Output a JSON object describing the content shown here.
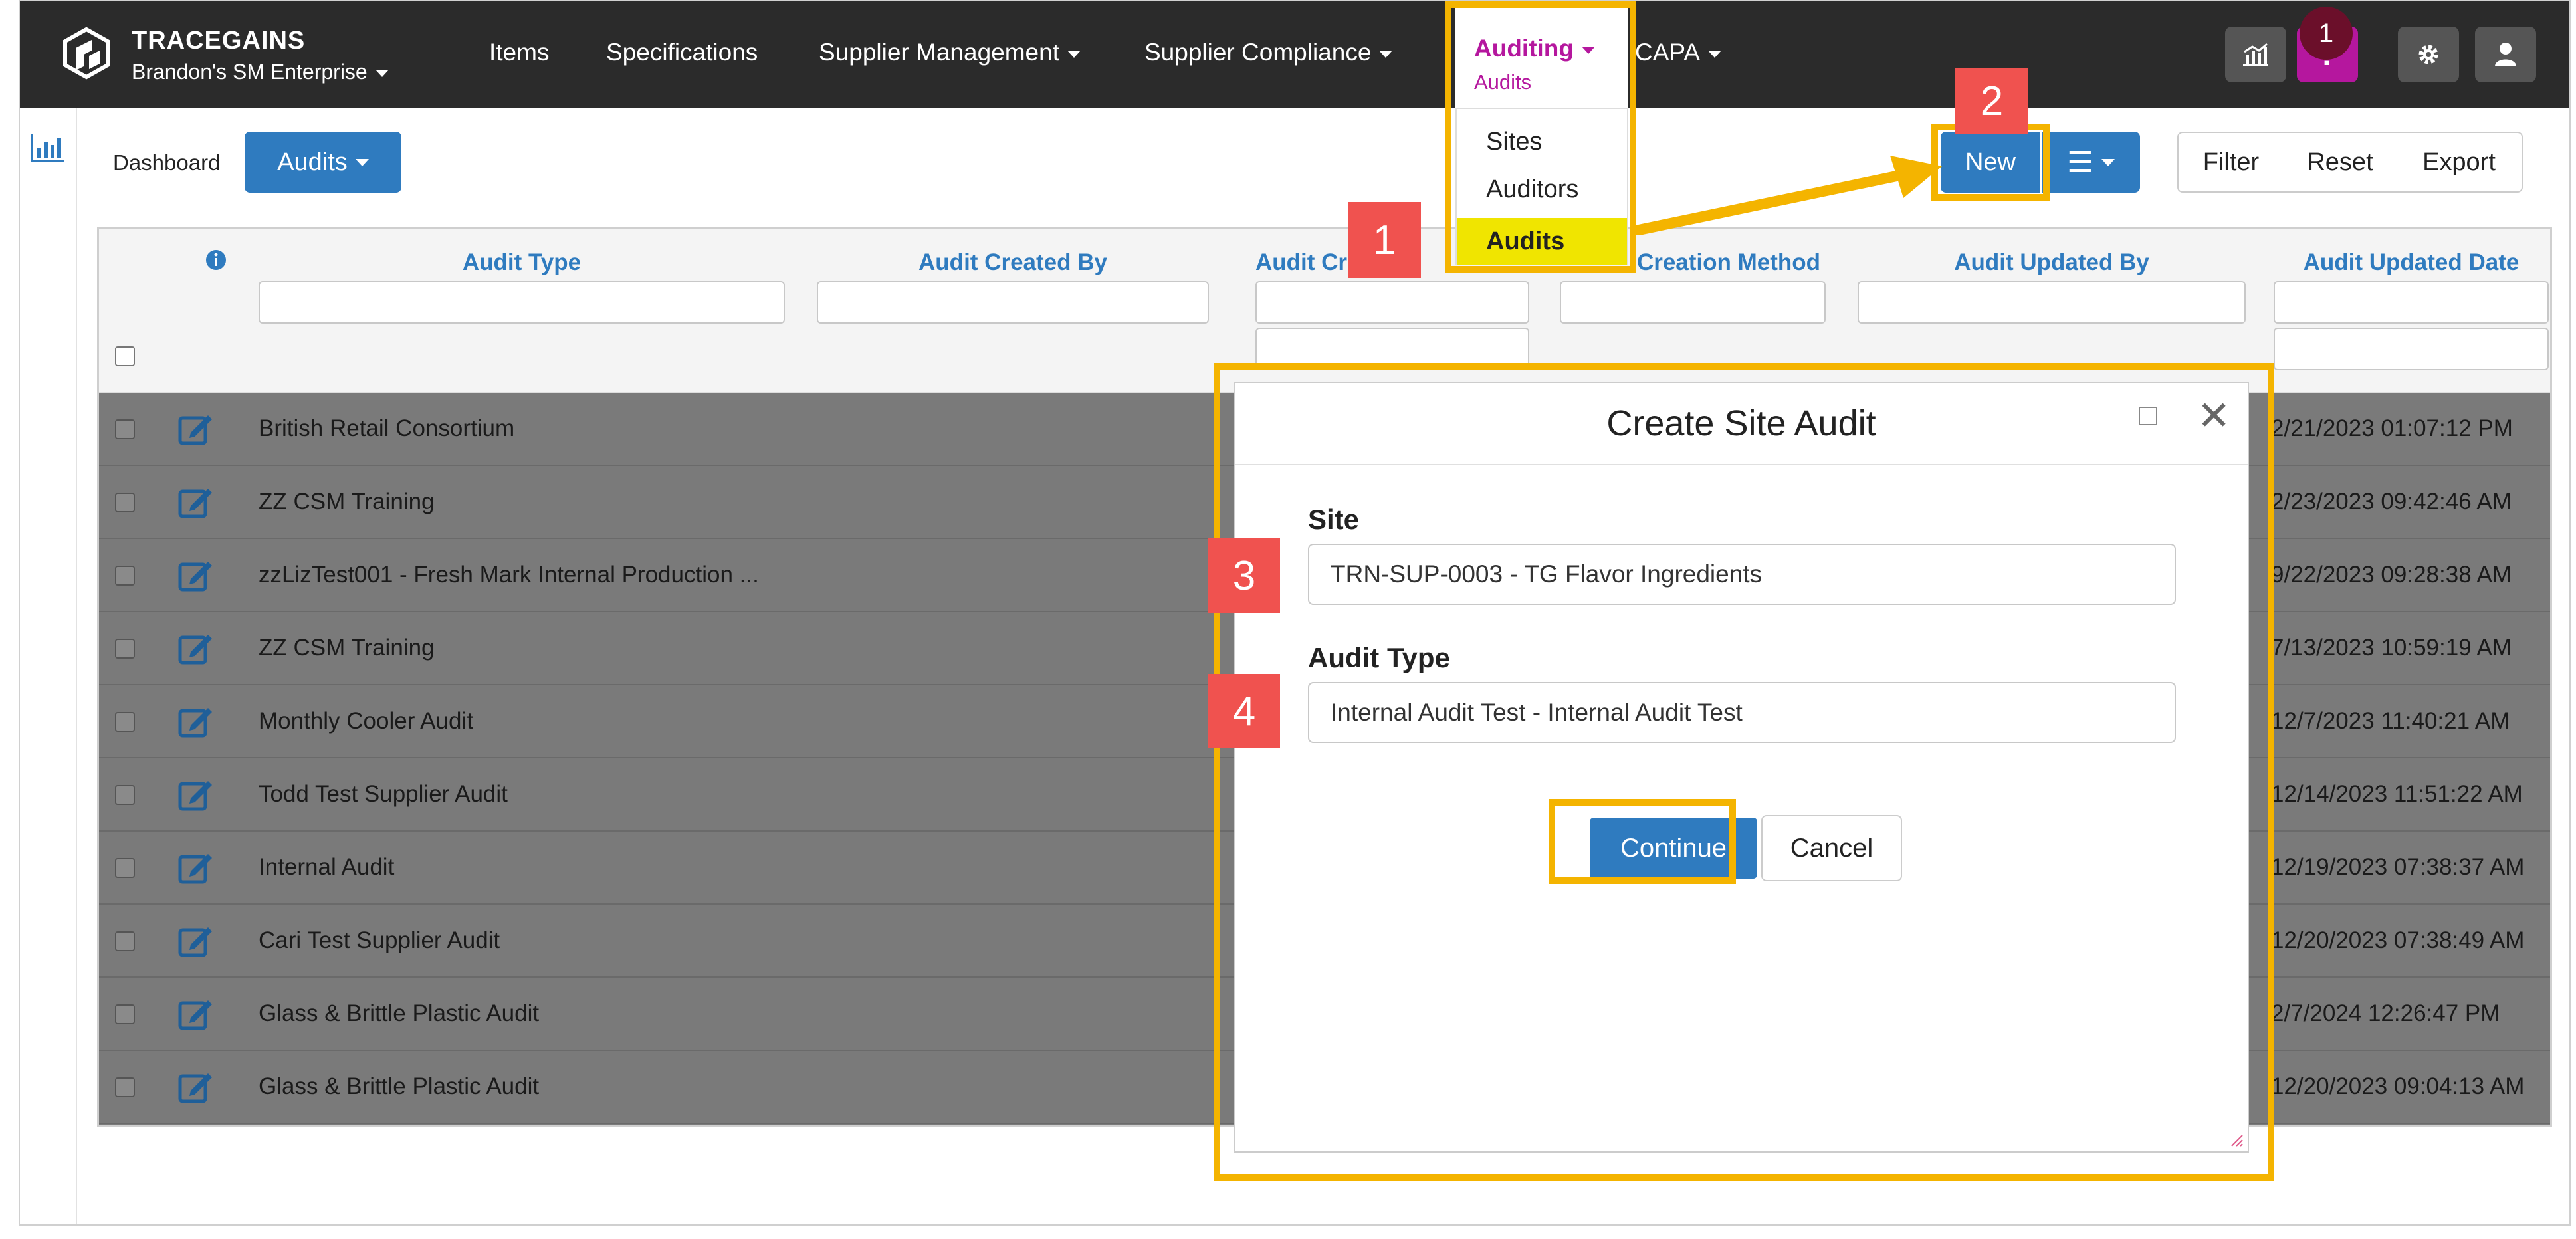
{
  "navbar": {
    "brand": "TRACEGAINS",
    "org": "Brandon's SM Enterprise",
    "items": [
      "Items",
      "Specifications",
      "Supplier Management",
      "Supplier Compliance",
      "Auditing",
      "CAPA"
    ],
    "auditing_sub": "Audits",
    "notification_count": "1",
    "icons": [
      "analytics-icon",
      "help-icon",
      "gear-icon",
      "user-icon"
    ]
  },
  "dropdown": {
    "items": [
      "Sites",
      "Auditors",
      "Audits"
    ],
    "active": "Audits"
  },
  "toolbar": {
    "breadcrumb": "Dashboard",
    "view_select": "Audits",
    "new_label": "New",
    "filter_label": "Filter",
    "reset_label": "Reset",
    "export_label": "Export"
  },
  "grid": {
    "columns": [
      "Audit Type",
      "Audit Created By",
      "Audit Cr",
      "Creation Method",
      "Audit Updated By",
      "Audit Updated Date"
    ],
    "rows": [
      {
        "name": "British Retail Consortium",
        "date": "2/21/2023 01:07:12 PM"
      },
      {
        "name": "ZZ CSM Training",
        "date": "2/23/2023 09:42:46 AM"
      },
      {
        "name": "zzLizTest001 - Fresh Mark Internal Production ...",
        "date": "9/22/2023 09:28:38 AM"
      },
      {
        "name": "ZZ CSM Training",
        "date": "7/13/2023 10:59:19 AM"
      },
      {
        "name": "Monthly Cooler Audit",
        "date": "12/7/2023 11:40:21 AM"
      },
      {
        "name": "Todd Test Supplier Audit",
        "date": "12/14/2023 11:51:22 AM"
      },
      {
        "name": "Internal Audit",
        "date": "12/19/2023 07:38:37 AM"
      },
      {
        "name": "Cari Test Supplier Audit",
        "date": "12/20/2023 07:38:49 AM"
      },
      {
        "name": "Glass & Brittle Plastic Audit",
        "date": "2/7/2024 12:26:47 PM"
      },
      {
        "name": "Glass & Brittle Plastic Audit",
        "date": "12/20/2023 09:04:13 AM"
      }
    ]
  },
  "modal": {
    "title": "Create Site Audit",
    "site_label": "Site",
    "site_value": "TRN-SUP-0003 - TG Flavor Ingredients",
    "audit_type_label": "Audit Type",
    "audit_type_value": "Internal Audit Test - Internal Audit Test",
    "continue_label": "Continue",
    "cancel_label": "Cancel"
  },
  "annotations": {
    "steps": [
      "1",
      "2",
      "3",
      "4"
    ],
    "highlight_color": "#f4b400",
    "step_color": "#f0524f"
  },
  "colors": {
    "navbar_bg": "#2b2b2b",
    "primary_blue": "#2f7bbf",
    "auditing_accent": "#b5179e"
  }
}
